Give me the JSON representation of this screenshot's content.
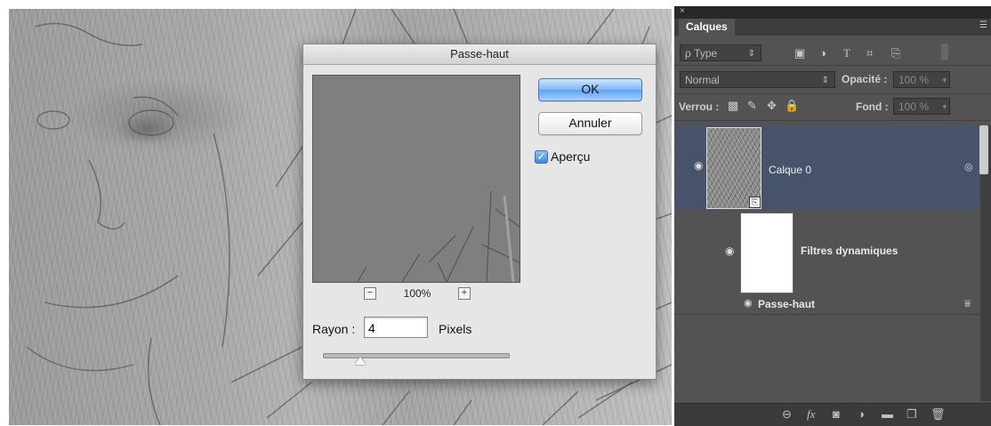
{
  "dialog": {
    "title": "Passe-haut",
    "ok_label": "OK",
    "cancel_label": "Annuler",
    "preview_checkbox_label": "Aperçu",
    "preview_checked": true,
    "zoom_value": "100%",
    "zoom_out_glyph": "−",
    "zoom_in_glyph": "+",
    "radius_label": "Rayon :",
    "radius_value": "4",
    "radius_unit": "Pixels"
  },
  "layers_panel": {
    "close_glyph": "×",
    "tab_label": "Calques",
    "filter_kind": "ρ Type",
    "blend_mode": "Normal",
    "opacity_label": "Opacité :",
    "opacity_value": "100 %",
    "lock_label": "Verrou :",
    "fill_label": "Fond :",
    "fill_value": "100 %",
    "layers": [
      {
        "name": "Calque 0",
        "selected": true
      },
      {
        "name": "Filtres dynamiques",
        "selected": false
      },
      {
        "name": "Passe-haut",
        "selected": false
      }
    ],
    "bottom_icons": [
      "link-icon",
      "fx-icon",
      "mask-icon",
      "adjustment-icon",
      "folder-icon",
      "new-layer-icon",
      "trash-icon"
    ]
  },
  "colors": {
    "panel_bg": "#535353",
    "selected_layer": "#47526b",
    "ok_button": "#5ea2f0"
  }
}
